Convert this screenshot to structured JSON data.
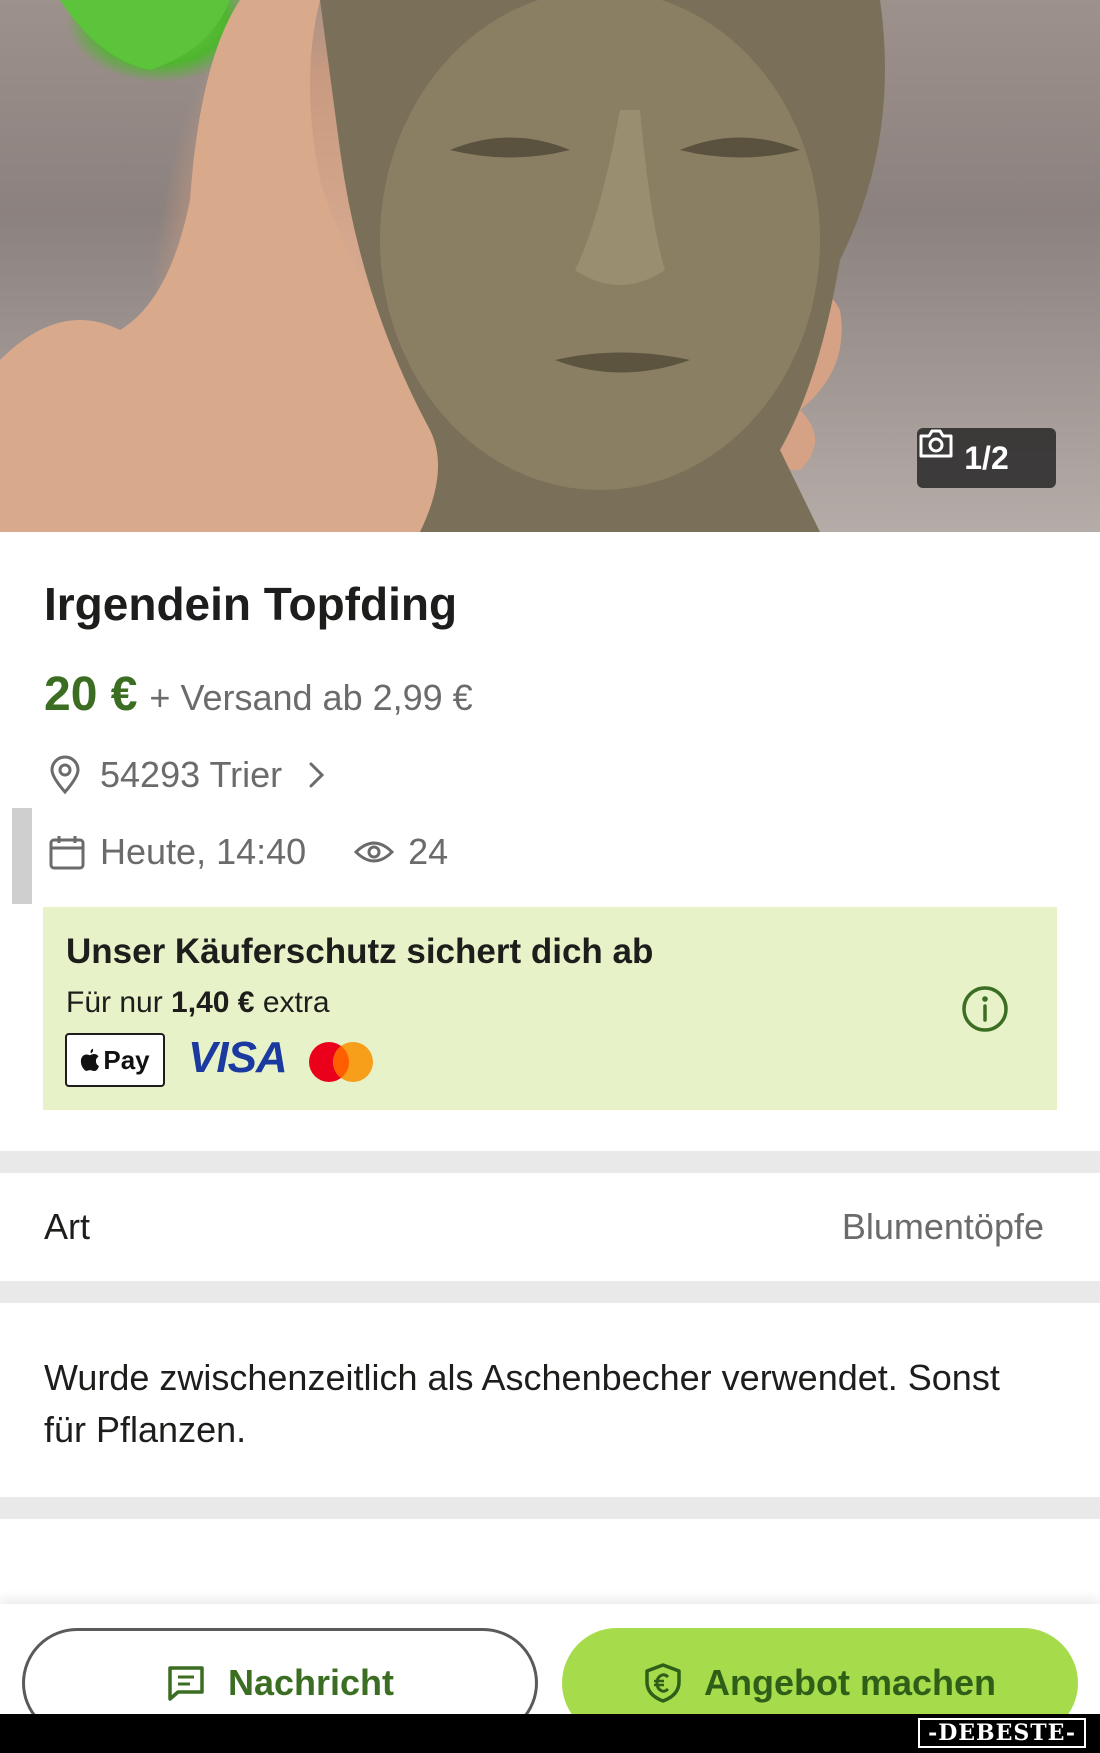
{
  "photo": {
    "counter": "1/2",
    "camera_icon": "camera-icon"
  },
  "listing": {
    "title": "Irgendein Topfding",
    "price": "20 €",
    "shipping": "+ Versand ab 2,99 €",
    "location": "54293 Trier",
    "date": "Heute, 14:40",
    "views": "24"
  },
  "protection": {
    "title": "Unser Käuferschutz sichert dich ab",
    "sub_prefix": "Für nur",
    "fee": "1,40 €",
    "sub_suffix": "extra",
    "apple_pay": "Pay",
    "visa": "VISA"
  },
  "attributes": {
    "label": "Art",
    "value": "Blumentöpfe"
  },
  "description": "Wurde zwischenzeitlich als Aschenbecher verwendet. Sonst für Pflanzen.",
  "actions": {
    "message_label": "Nachricht",
    "offer_label": "Angebot machen"
  },
  "watermark": {
    "bottom": "-DEBESTE-"
  },
  "colors": {
    "price_green": "#3b6e22",
    "protection_bg": "#e7f2c9",
    "offer_button": "#a6dc4c"
  }
}
